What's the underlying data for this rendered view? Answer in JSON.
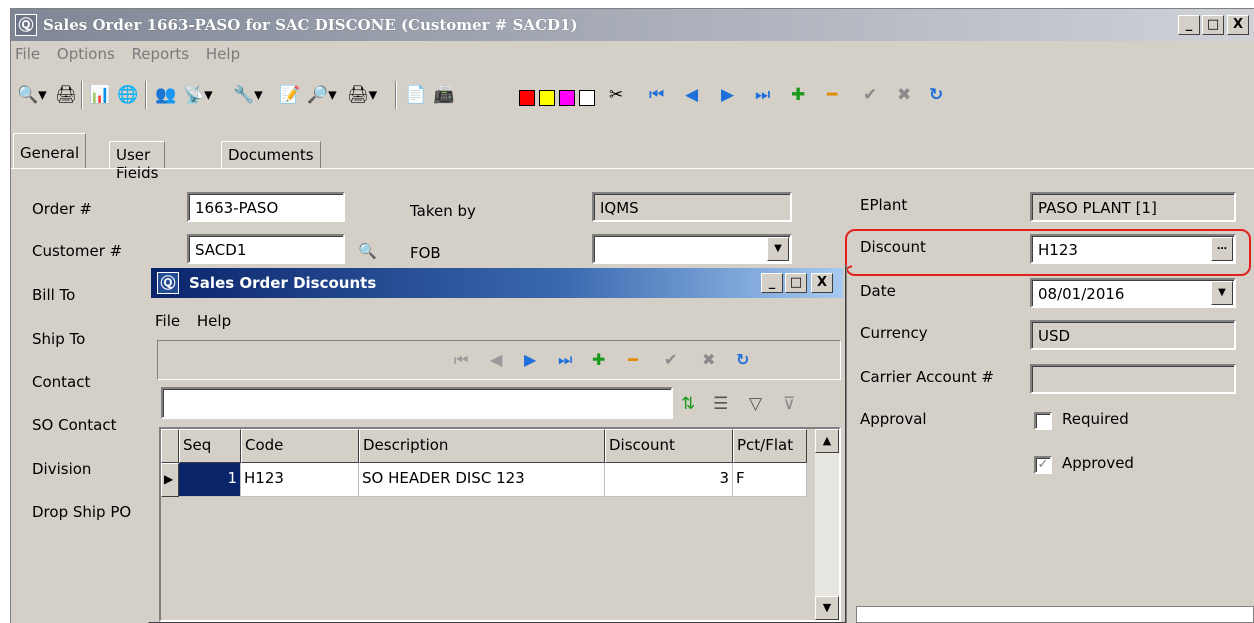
{
  "window": {
    "title": "Sales Order 1663-PASO for SAC DISCONE (Customer # SACD1)",
    "minimize": "_",
    "maximize": "□",
    "close": "X"
  },
  "menu": [
    "File",
    "Options",
    "Reports",
    "Help"
  ],
  "tabs": [
    "General",
    "User Fields",
    "Documents"
  ],
  "form": {
    "order_label": "Order #",
    "order_value": "1663-PASO",
    "customer_label": "Customer #",
    "customer_value": "SACD1",
    "bill_to_label": "Bill To",
    "ship_to_label": "Ship To",
    "contact_label": "Contact",
    "so_contact_label": "SO Contact",
    "division_label": "Division",
    "drop_ship_label": "Drop Ship PO",
    "taken_by_label": "Taken by",
    "taken_by_value": "IQMS",
    "fob_label": "FOB",
    "fob_value": "",
    "eplant_label": "EPlant",
    "eplant_value": "PASO PLANT [1]",
    "discount_label": "Discount",
    "discount_value": "H123",
    "date_label": "Date",
    "date_value": "08/01/2016",
    "currency_label": "Currency",
    "currency_value": "USD",
    "carrier_label": "Carrier Account #",
    "carrier_value": "",
    "approval_label": "Approval",
    "required_label": "Required",
    "approved_label": "Approved"
  },
  "dialog": {
    "title": "Sales Order Discounts",
    "menu": [
      "File",
      "Help"
    ],
    "search_value": "",
    "columns": [
      "Seq",
      "Code",
      "Description",
      "Discount",
      "Pct/Flat"
    ],
    "rows": [
      {
        "seq": "1",
        "code": "H123",
        "description": "SO HEADER DISC 123",
        "discount": "3",
        "pct_flat": "F"
      }
    ]
  },
  "colors": {
    "highlight": "#e0201b",
    "swatch_red": "#ff0000",
    "swatch_yellow": "#ffff00",
    "swatch_magenta": "#ff00ff",
    "swatch_white": "#ffffff",
    "nav_blue": "#1e6fd9",
    "add_green": "#1a9a1a",
    "remove_orange": "#e08a00"
  }
}
